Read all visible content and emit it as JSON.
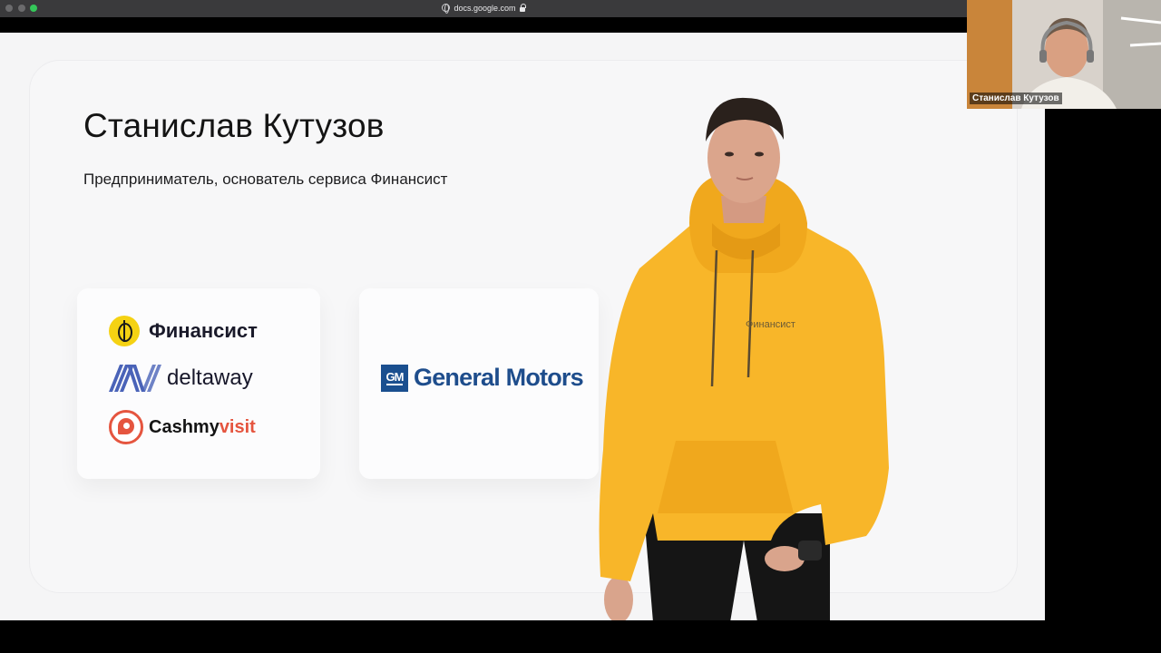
{
  "browser": {
    "url": "docs.google.com"
  },
  "slide": {
    "title": "Станислав Кутузов",
    "subtitle": "Предприниматель, основатель сервиса Финансист",
    "logos": {
      "finansist": "Финансист",
      "deltaway": "deltaway",
      "cashmyvisit_a": "Cashmy",
      "cashmyvisit_b": "visit",
      "gm_badge": "GM",
      "general_motors": "General Motors"
    },
    "hoodie_text": "Финансист"
  },
  "video_call": {
    "participant_name": "Станислав Кутузов"
  },
  "colors": {
    "hoodie": "#f8b629",
    "finansist_yellow": "#f5d213",
    "cash_accent": "#e5553f",
    "gm_blue": "#1e4d8c"
  }
}
